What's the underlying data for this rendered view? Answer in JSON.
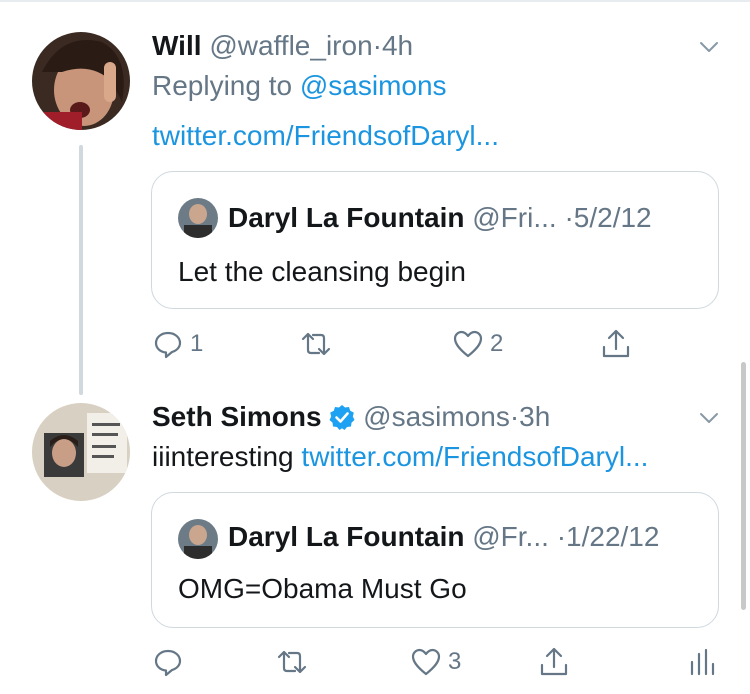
{
  "tweets": [
    {
      "name": "Will",
      "handle": "@waffle_iron",
      "time": "4h",
      "replying_prefix": "Replying to",
      "replying_to": "@sasimons",
      "link": "twitter.com/FriendsofDaryl...",
      "quote": {
        "name": "Daryl La Fountain",
        "handle": "@Fri...",
        "date": "5/2/12",
        "text": "Let the cleansing begin"
      },
      "actions": {
        "replies": "1",
        "retweets": "",
        "likes": "2"
      }
    },
    {
      "name": "Seth Simons",
      "verified": true,
      "handle": "@sasimons",
      "time": "3h",
      "text_plain": "iiinteresting",
      "link": "twitter.com/FriendsofDaryl...",
      "quote": {
        "name": "Daryl La Fountain",
        "handle": "@Fr...",
        "date": "1/22/12",
        "text": "OMG=Obama Must Go"
      },
      "actions": {
        "replies": "",
        "retweets": "",
        "likes": "3"
      }
    }
  ],
  "separator_dot": "·",
  "colors": {
    "link": "#1b95e0",
    "muted": "#657786",
    "verified": "#1da1f2",
    "border": "#cfd9de"
  },
  "icons": [
    "reply-icon",
    "retweet-icon",
    "like-icon",
    "share-icon",
    "analytics-icon",
    "chevron-down-icon",
    "verified-badge-icon"
  ]
}
